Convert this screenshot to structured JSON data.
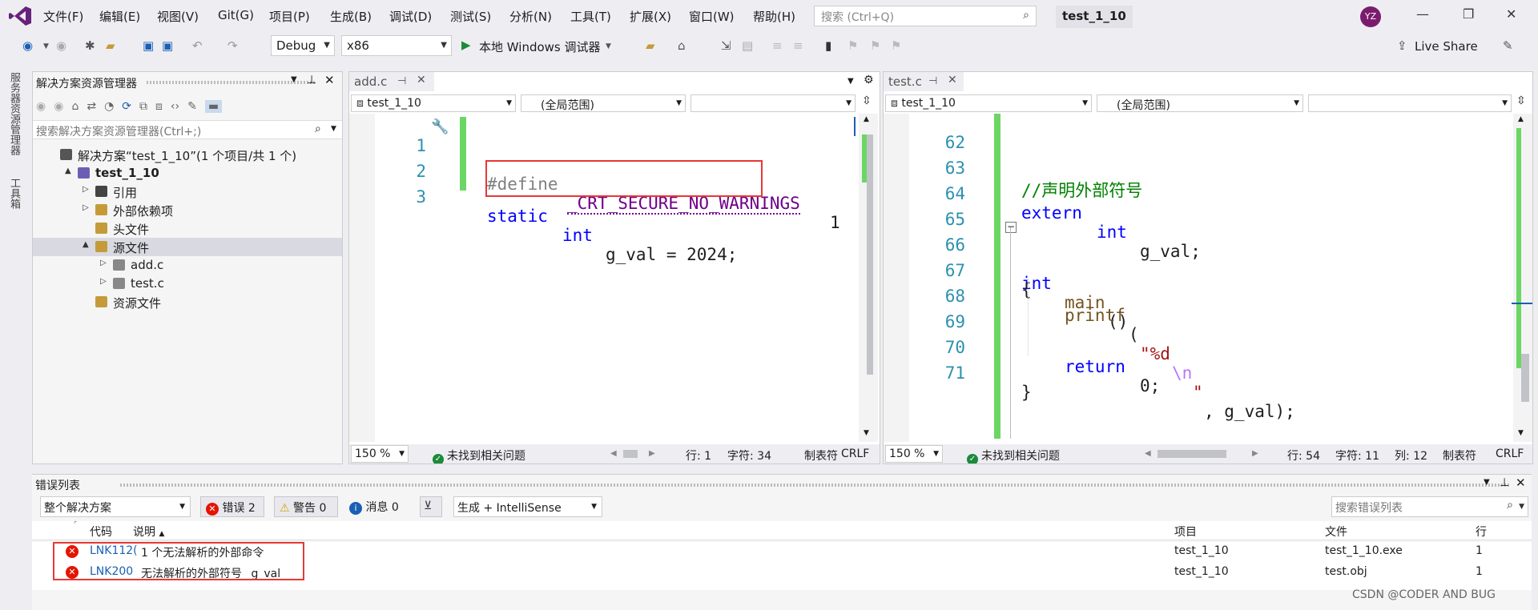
{
  "menu": [
    "文件(F)",
    "编辑(E)",
    "视图(V)",
    "Git(G)",
    "项目(P)",
    "生成(B)",
    "调试(D)",
    "测试(S)",
    "分析(N)",
    "工具(T)",
    "扩展(X)",
    "窗口(W)",
    "帮助(H)"
  ],
  "search": {
    "placeholder": "搜索 (Ctrl+Q)"
  },
  "solution_title": "test_1_10",
  "avatar": "YZ",
  "toolbar": {
    "config": "Debug",
    "platform": "x86",
    "debugger": "本地 Windows 调试器",
    "live_share": "Live Share"
  },
  "side_tabs": [
    "服务器资源管理器",
    "工具箱"
  ],
  "solution_explorer": {
    "title": "解决方案资源管理器",
    "search_placeholder": "搜索解决方案资源管理器(Ctrl+;)",
    "tree": [
      {
        "label": "解决方案“test_1_10”(1 个项目/共 1 个)",
        "level": 0,
        "bold": false,
        "twisty": ""
      },
      {
        "label": "test_1_10",
        "level": 1,
        "bold": true,
        "twisty": "▲"
      },
      {
        "label": "引用",
        "level": 2,
        "bold": false,
        "twisty": "▷"
      },
      {
        "label": "外部依赖项",
        "level": 2,
        "bold": false,
        "twisty": "▷"
      },
      {
        "label": "头文件",
        "level": 2,
        "bold": false,
        "twisty": ""
      },
      {
        "label": "源文件",
        "level": 2,
        "bold": false,
        "twisty": "▲",
        "selected": true
      },
      {
        "label": "add.c",
        "level": 3,
        "bold": false,
        "twisty": "▷"
      },
      {
        "label": "test.c",
        "level": 3,
        "bold": false,
        "twisty": "▷"
      },
      {
        "label": "资源文件",
        "level": 2,
        "bold": false,
        "twisty": ""
      }
    ]
  },
  "editor_left": {
    "tab": "add.c",
    "project": "test_1_10",
    "scope": "(全局范围)",
    "lines": [
      "1",
      "2",
      "3"
    ],
    "code_line1_pp": "#define",
    "code_line1_macro": "_CRT_SECURE_NO_WARNINGS",
    "code_line1_val": "1",
    "code_line3_kw1": "static",
    "code_line3_kw2": "int",
    "code_line3_rest": "g_val = 2024;",
    "zoom": "150 %",
    "issues": "未找到相关问题",
    "line": "行: 1",
    "chars": "字符: 34",
    "tabs": "制表符",
    "eol": "CRLF"
  },
  "editor_right": {
    "tab": "test.c",
    "project": "test_1_10",
    "scope": "(全局范围)",
    "lines": [
      "62",
      "63",
      "64",
      "65",
      "66",
      "67",
      "68",
      "69",
      "70",
      "71"
    ],
    "comment": "//声明外部符号",
    "extern_kw": "extern",
    "int_kw": "int",
    "extern_rest": "g_val;",
    "main_kw": "int",
    "main_fn": "main",
    "main_paren": "()",
    "brace_open": "{",
    "printf_fn": "printf",
    "printf_open": "(",
    "printf_str1": "\"%d",
    "printf_esc": "\\n",
    "printf_str2": "\"",
    "printf_rest": ", g_val);",
    "return_kw": "return",
    "return_rest": "0;",
    "brace_close": "}",
    "zoom": "150 %",
    "issues": "未找到相关问题",
    "line": "行: 54",
    "chars": "字符: 11",
    "col": "列: 12",
    "tabs": "制表符",
    "eol": "CRLF"
  },
  "error_list": {
    "title": "错误列表",
    "scope": "整个解决方案",
    "errors_btn": "错误 2",
    "warnings_btn": "警告 0",
    "messages_btn": "消息 0",
    "source": "生成 + IntelliSense",
    "search_placeholder": "搜索错误列表",
    "columns": {
      "code": "代码",
      "desc": "说明",
      "project": "项目",
      "file": "文件",
      "line": "行"
    },
    "rows": [
      {
        "code": "LNK112(",
        "desc": "1 个无法解析的外部命令",
        "project": "test_1_10",
        "file": "test_1_10.exe",
        "line": "1"
      },
      {
        "code": "LNK200",
        "desc": "无法解析的外部符号 _g_val",
        "project": "test_1_10",
        "file": "test.obj",
        "line": "1"
      }
    ]
  },
  "watermark": "CSDN @CODER AND BUG",
  "colors": {
    "keyword": "#0000ff",
    "comment": "#008000",
    "macro": "#6f008a",
    "highlight_box": "#e53935",
    "change_bar": "#6cd664",
    "error": "#e51400"
  }
}
